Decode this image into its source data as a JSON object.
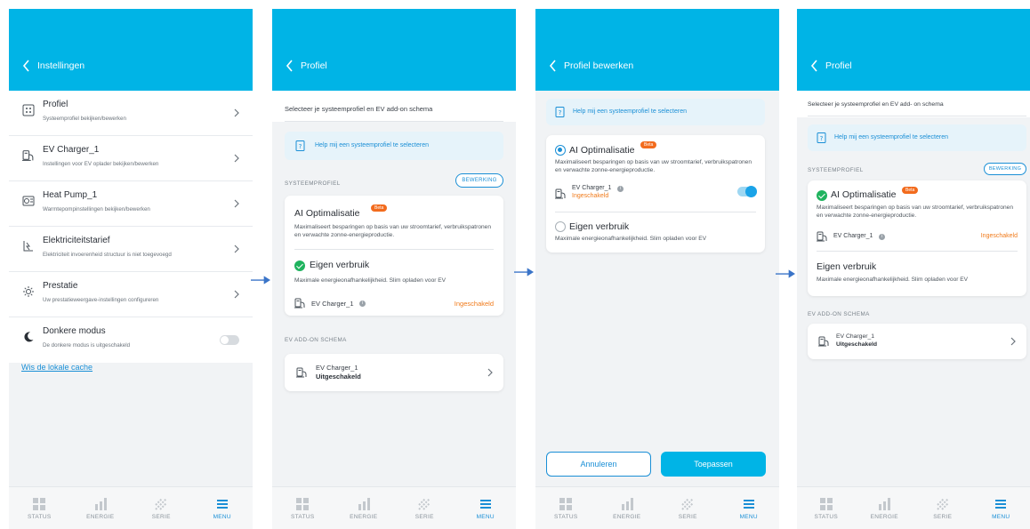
{
  "colors": {
    "header": "#00b4e6",
    "accent": "#1a8fd6",
    "enabled": "#f07a1a",
    "check": "#1fb35e",
    "beta": "#f26b1d"
  },
  "nav": [
    {
      "label": "STATUS",
      "icon": "grid-icon",
      "active": false
    },
    {
      "label": "ENERGIE",
      "icon": "bar-chart-icon",
      "active": false
    },
    {
      "label": "SERIE",
      "icon": "series-icon",
      "active": false
    },
    {
      "label": "MENU",
      "icon": "menu-icon",
      "active": true
    }
  ],
  "screen1": {
    "title": "Instellingen",
    "items": [
      {
        "title": "Profiel",
        "subtitle": "Systeemprofiel bekijken/bewerken",
        "icon": "profile-icon"
      },
      {
        "title": "EV Charger_1",
        "subtitle": "Instellingen voor EV oplader bekijken/bewerken",
        "icon": "ev-charger-icon"
      },
      {
        "title": "Heat Pump_1",
        "subtitle": "Warmtepompinstellingen bekijken/bewerken",
        "icon": "heat-pump-icon"
      },
      {
        "title": "Elektriciteitstarief",
        "subtitle": "Elektriciteit invoerenheid structuur is niet toegevoegd",
        "icon": "tariff-icon"
      },
      {
        "title": "Prestatie",
        "subtitle": "Uw prestatieweergave-instellingen configureren",
        "icon": "sun-icon"
      },
      {
        "title": "Donkere modus",
        "subtitle": "De donkere modus is uitgeschakeld",
        "icon": "moon-icon"
      }
    ],
    "cache_link": "Wis de lokale cache"
  },
  "screen2": {
    "title": "Profiel",
    "intro": "Selecteer je systeemprofiel en EV add-on schema",
    "help": "Help mij een systeemprofiel te selecteren",
    "section_profile": "SYSTEEMPROFIEL",
    "edit": "BEWERKING",
    "ai_title": "AI Optimalisatie",
    "beta": "Beta",
    "ai_desc": "Maximaliseert besparingen op basis van uw stroomtarief, verbruikspatronen en verwachte zonne-energieproductie.",
    "own_title": "Eigen verbruik",
    "own_desc": "Maximale energieonafhankelijkheid. Slim opladen voor EV",
    "ev_name": "EV Charger_1",
    "ev_status": "Ingeschakeld",
    "section_addon": "EV ADD-ON SCHEMA",
    "addon_name": "EV Charger_1",
    "addon_state": "Uitgeschakeld"
  },
  "screen3": {
    "title": "Profiel bewerken",
    "help": "Help mij een systeemprofiel te selecteren",
    "ai_title": "AI Optimalisatie",
    "beta": "Beta",
    "ai_desc": "Maximaliseert besparingen op basis van uw stroomtarief, verbruikspatronen en verwachte zonne-energieproductie.",
    "ev_name": "EV Charger_1",
    "ev_status": "Ingeschakeld",
    "own_title": "Eigen verbruik",
    "own_desc": "Maximale energieonafhankelijkheid. Slim opladen voor EV",
    "cancel": "Annuleren",
    "apply": "Toepassen"
  },
  "screen4": {
    "title": "Profiel",
    "intro": "Selecteer je systeemprofiel en EV add- on schema",
    "help": "Help mij een systeemprofiel te selecteren",
    "section_profile": "SYSTEEMPROFIEL",
    "edit": "BEWERKING",
    "ai_title": "AI Optimalisatie",
    "beta": "Beta",
    "ai_desc": "Maximaliseert besparingen op basis van uw stroomtarief, verbruikspatronen en verwachte zonne-energieproductie.",
    "ev_name": "EV Charger_1",
    "ev_status": "Ingeschakeld",
    "own_title": "Eigen verbruik",
    "own_desc": "Maximale energieonafhankelijkheid. Slim opladen voor EV",
    "section_addon": "EV ADD-ON SCHEMA",
    "addon_name": "EV Charger_1",
    "addon_state": "Uitgeschakeld"
  }
}
